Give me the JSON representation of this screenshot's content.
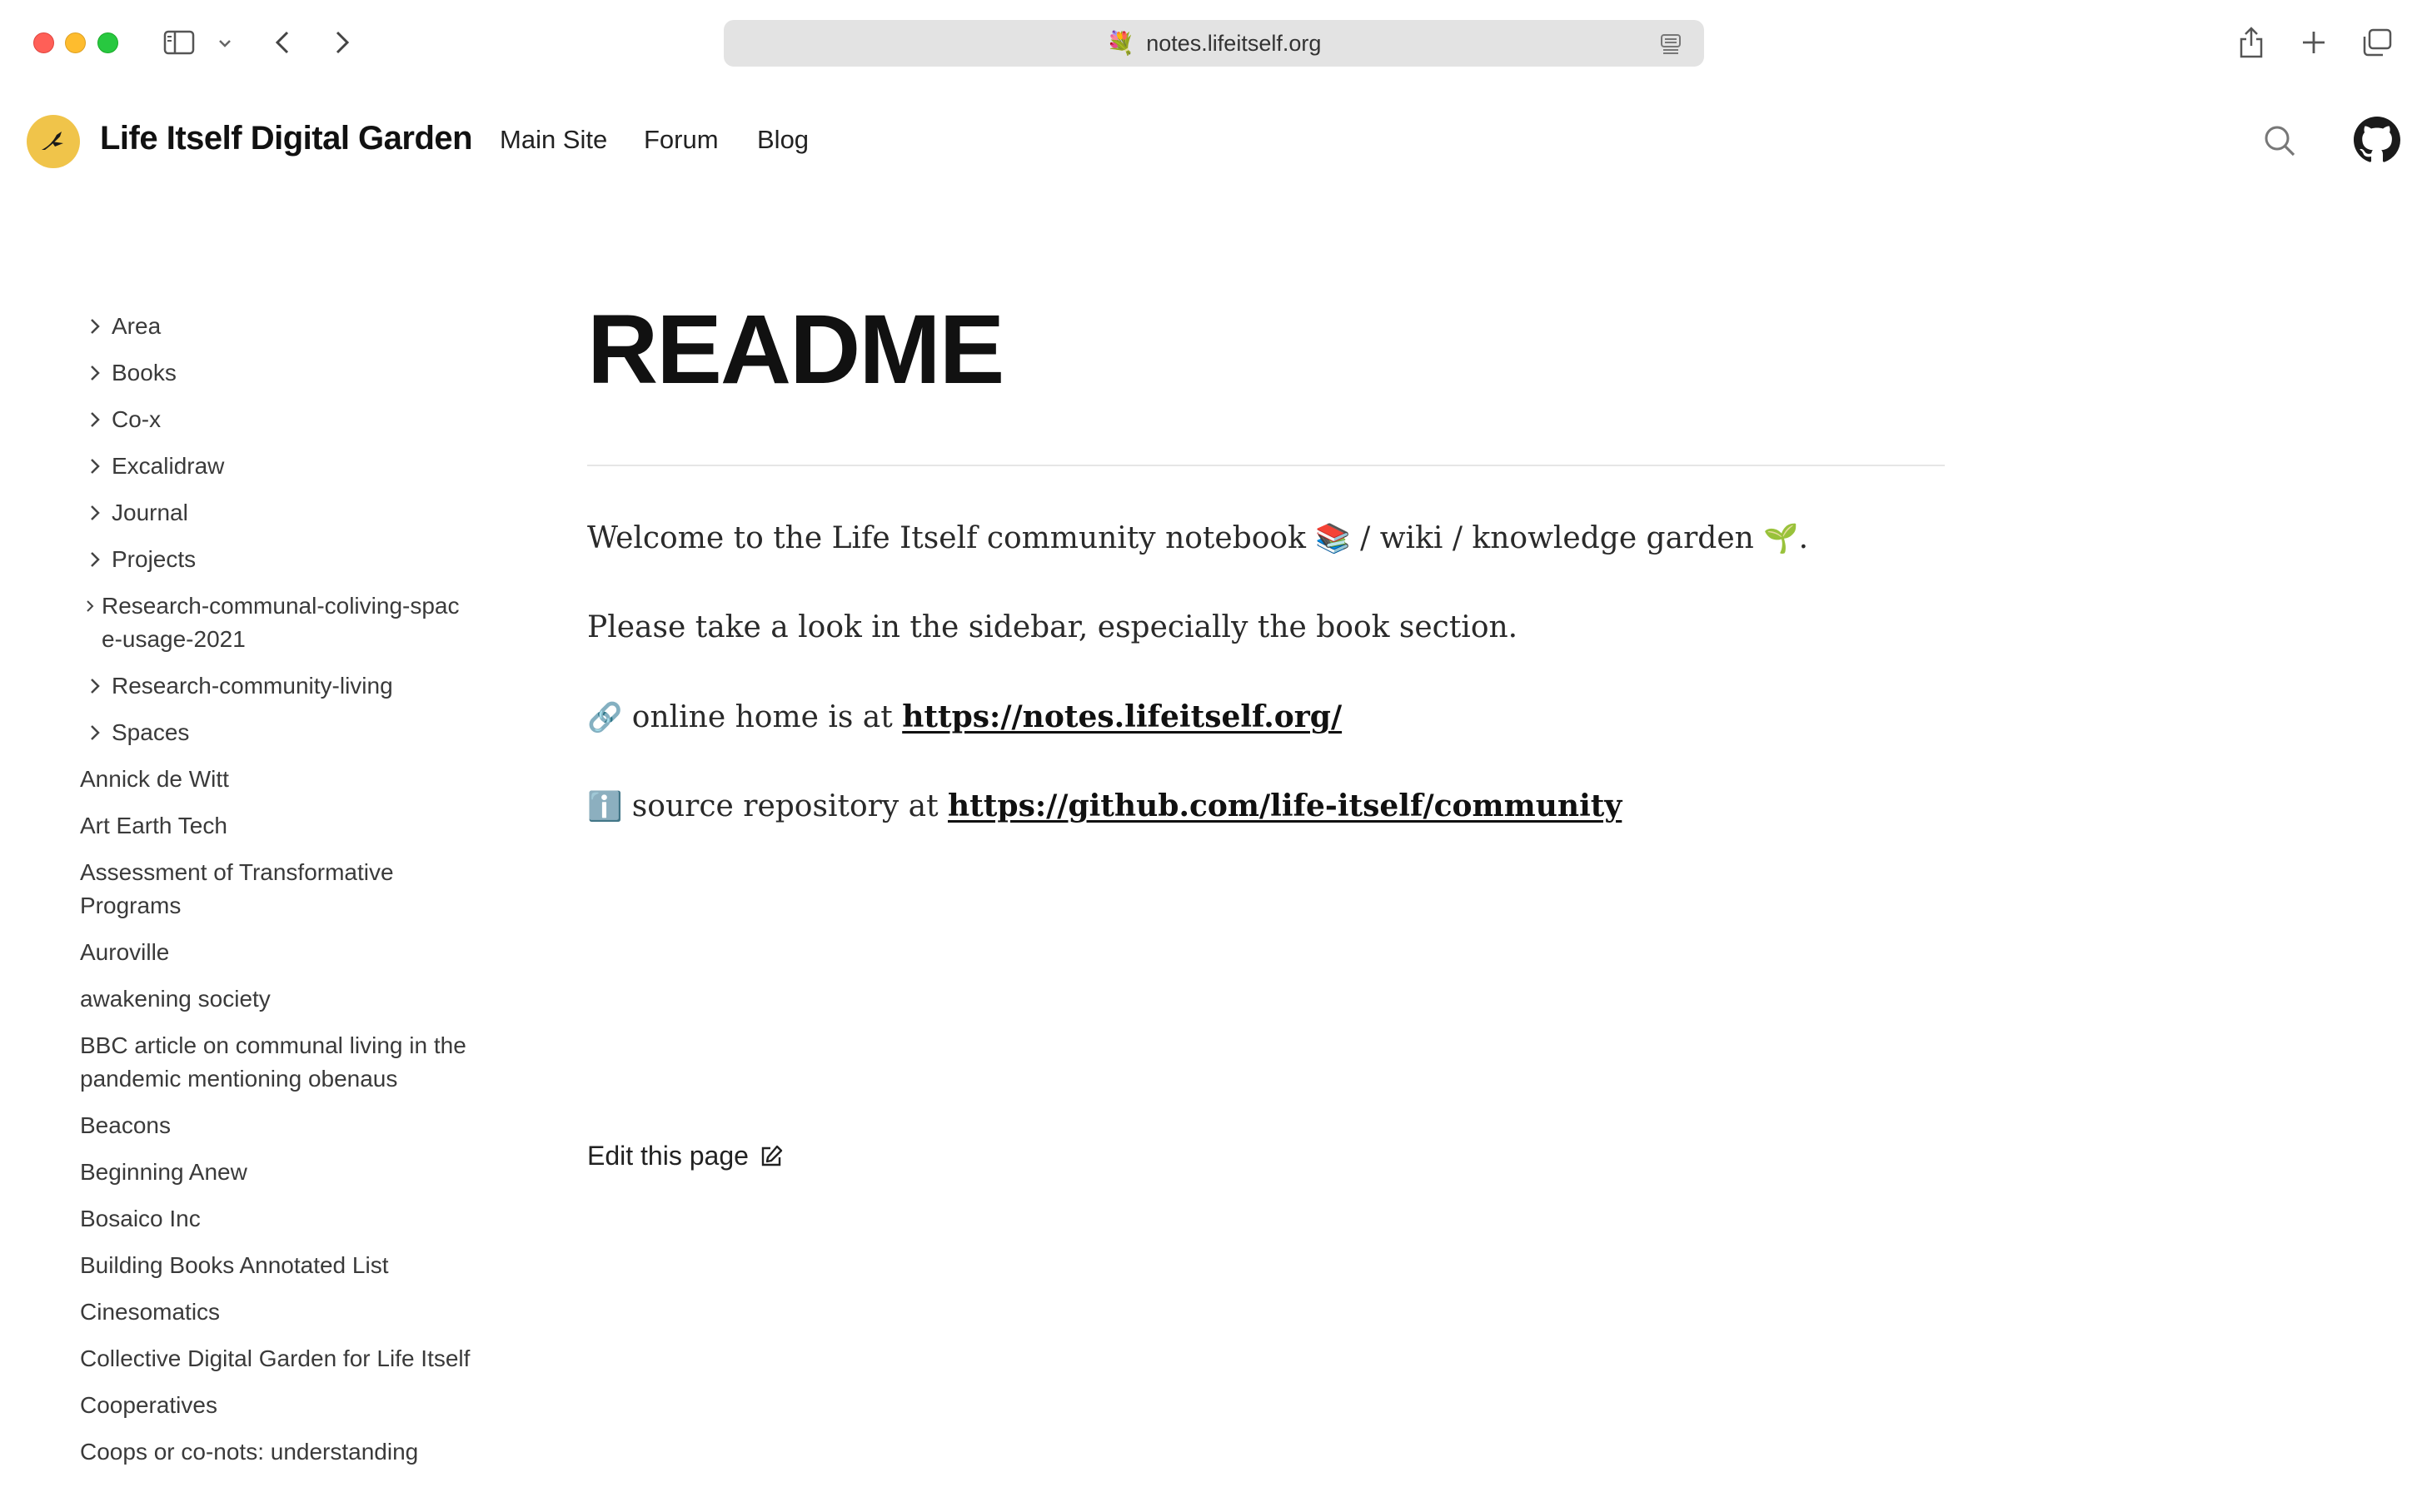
{
  "browser": {
    "url": "notes.lifeitself.org",
    "favicon": "💐"
  },
  "site": {
    "title": "Life Itself Digital Garden",
    "nav": [
      "Main Site",
      "Forum",
      "Blog"
    ]
  },
  "sidebar": {
    "folders": [
      "Area",
      "Books",
      "Co-x",
      "Excalidraw",
      "Journal",
      "Projects",
      "Research-communal-coliving-space-usage-2021",
      "Research-community-living",
      "Spaces"
    ],
    "pages": [
      "Annick de Witt",
      "Art Earth Tech",
      "Assessment of Transformative Programs",
      "Auroville",
      "awakening society",
      "BBC article on communal living in the pandemic mentioning obenaus",
      "Beacons",
      "Beginning Anew",
      "Bosaico Inc",
      "Building Books Annotated List",
      "Cinesomatics",
      "Collective Digital Garden for Life Itself",
      "Cooperatives",
      "Coops or co-nots: understanding"
    ]
  },
  "main": {
    "title": "README",
    "welcome_pre": "Welcome to the Life Itself community notebook",
    "welcome_mid": "/ wiki / knowledge garden",
    "welcome_end": ".",
    "emoji_books": "📚",
    "emoji_seedling": "🌱",
    "sidebar_note": "Please take a look in the sidebar, especially the book section.",
    "home_emoji": "🔗",
    "home_pre": "online home is at",
    "home_url": "https://notes.lifeitself.org/",
    "source_emoji": "ℹ️",
    "source_pre": "source repository at",
    "source_url": "https://github.com/life-itself/community",
    "edit_label": "Edit this page"
  }
}
